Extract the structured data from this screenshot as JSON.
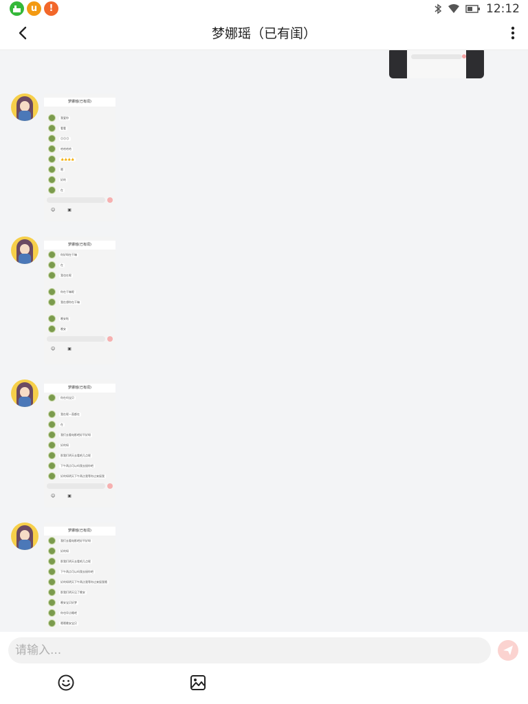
{
  "status_bar": {
    "time": "12:12",
    "app_icons": [
      {
        "name": "cleaner-app-icon",
        "glyph": "⌂",
        "color": "#35b839"
      },
      {
        "name": "u-app-icon",
        "glyph": "u",
        "color": "#f39a12"
      },
      {
        "name": "alert-app-icon",
        "glyph": "!",
        "color": "#f2672a"
      }
    ],
    "system_icons": [
      "bluetooth-icon",
      "wifi-icon",
      "battery-icon"
    ]
  },
  "header": {
    "title": "梦娜瑶（已有闺）",
    "back_icon": "chevron-left-icon",
    "more_icon": "more-vertical-icon"
  },
  "chat": {
    "messages": [
      {
        "shot_title": "梦娜瑶(已有闺)",
        "rows": [
          "我爱你",
          "看看",
          "😊😊😊",
          "哈哈哈哈",
          "👍👍👍👍",
          "嗯",
          "好的",
          "在"
        ]
      },
      {
        "shot_title": "梦娜瑶(已有闺)",
        "rows": [
          "你好呀在干嘛",
          "在",
          "我也在呢",
          "你在干嘛呢",
          "我在想你在干嘛",
          "晚安啦",
          "晚安"
        ]
      },
      {
        "shot_title": "梦娜瑶(已有闺)",
        "rows": [
          "你在吗宝贝",
          "我在呢一直都在",
          "在",
          "我们去看电影吧好不好呀",
          "好的呀",
          "那我们明天去看吧几点呢",
          "下午两点可以吗我去接你吧",
          "好的呀明天下午两点我等你过来接我"
        ]
      },
      {
        "shot_title": "梦娜瑶(已有闺)",
        "rows": [
          "我们去看电影吧好不好呀",
          "好的呀",
          "那我们明天去看吧几点呢",
          "下午两点可以吗我去接你吧",
          "好的呀明天下午两点我等你过来接我哦",
          "那我们明天见了晚安",
          "晚安宝贝好梦",
          "你也早点睡吧",
          "嗯嗯晚安宝贝"
        ]
      }
    ]
  },
  "input_bar": {
    "placeholder": "请输入...",
    "send_icon": "send-icon",
    "emoji_icon": "emoji-icon",
    "image_icon": "image-icon",
    "send_color": "#fbd3d0"
  }
}
